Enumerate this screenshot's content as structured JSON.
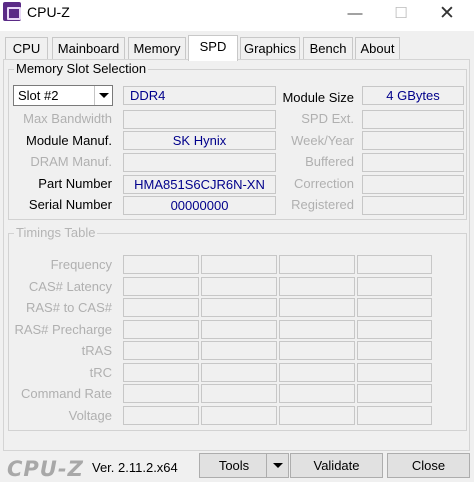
{
  "window": {
    "title": "CPU-Z"
  },
  "tabs": [
    "CPU",
    "Mainboard",
    "Memory",
    "SPD",
    "Graphics",
    "Bench",
    "About"
  ],
  "memory_slot": {
    "group_title": "Memory Slot Selection",
    "slot_selected": "Slot #2",
    "memory_type": "DDR4",
    "labels": {
      "max_bandwidth": "Max Bandwidth",
      "module_manuf": "Module Manuf.",
      "dram_manuf": "DRAM Manuf.",
      "part_number": "Part Number",
      "serial_number": "Serial Number",
      "module_size": "Module Size",
      "spd_ext": "SPD Ext.",
      "week_year": "Week/Year",
      "buffered": "Buffered",
      "correction": "Correction",
      "registered": "Registered"
    },
    "values": {
      "max_bandwidth": "",
      "module_manuf": "SK Hynix",
      "dram_manuf": "",
      "part_number": "HMA851S6CJR6N-XN",
      "serial_number": "00000000",
      "module_size": "4 GBytes",
      "spd_ext": "",
      "week_year": "",
      "buffered": "",
      "correction": "",
      "registered": ""
    }
  },
  "timings": {
    "group_title": "Timings Table",
    "rows": [
      "Frequency",
      "CAS# Latency",
      "RAS# to CAS#",
      "RAS# Precharge",
      "tRAS",
      "tRC",
      "Command Rate",
      "Voltage"
    ]
  },
  "footer": {
    "logo": "CPU-Z",
    "version": "Ver. 2.11.2.x64",
    "tools_label": "Tools",
    "validate_label": "Validate",
    "close_label": "Close"
  }
}
